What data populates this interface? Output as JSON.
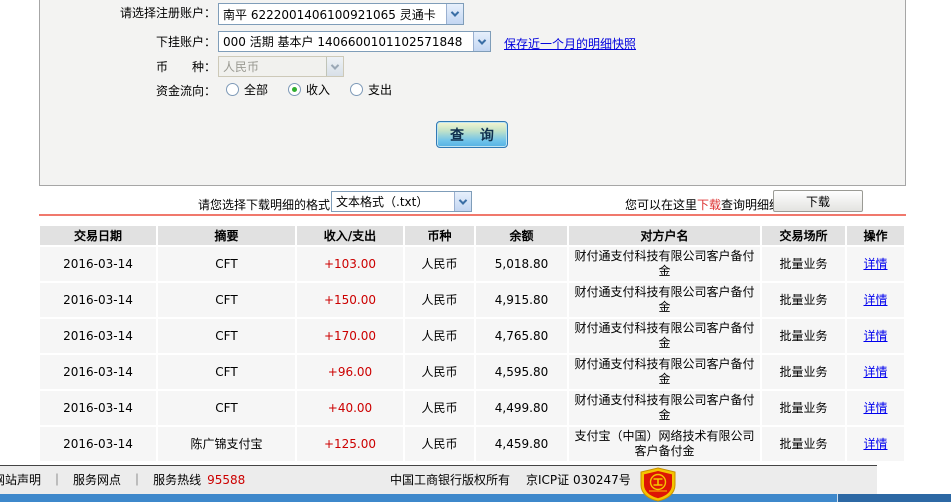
{
  "form": {
    "register_account_label": "请选择注册账户：",
    "register_account_value": "南平  6222001406100921065  灵通卡",
    "sub_account_label": "下挂账户：",
    "sub_account_value": "000  活期  基本户  1406600101102571848",
    "snapshot_link": "保存近一个月的明细快照",
    "currency_label": "币　　种：",
    "currency_value": "人民币",
    "flow_label": "资金流向：",
    "flow_options": [
      {
        "label": "全部",
        "selected": false
      },
      {
        "label": "收入",
        "selected": true
      },
      {
        "label": "支出",
        "selected": false
      }
    ],
    "query_button": "查 询"
  },
  "download": {
    "format_label": "请您选择下载明细的格式",
    "format_value": "文本格式（.txt）",
    "hint_prefix": "您可以在这里",
    "hint_link": "下载",
    "hint_suffix": "查询明细结果",
    "download_button": "下载"
  },
  "table": {
    "headers": [
      "交易日期",
      "摘要",
      "收入/支出",
      "币种",
      "余额",
      "对方户名",
      "交易场所",
      "操作"
    ],
    "rows": [
      {
        "date": "2016-03-14",
        "summary": "CFT",
        "amount": "+103.00",
        "currency": "人民币",
        "balance": "5,018.80",
        "counterparty": "财付通支付科技有限公司客户备付金",
        "venue": "批量业务",
        "action": "详情"
      },
      {
        "date": "2016-03-14",
        "summary": "CFT",
        "amount": "+150.00",
        "currency": "人民币",
        "balance": "4,915.80",
        "counterparty": "财付通支付科技有限公司客户备付金",
        "venue": "批量业务",
        "action": "详情"
      },
      {
        "date": "2016-03-14",
        "summary": "CFT",
        "amount": "+170.00",
        "currency": "人民币",
        "balance": "4,765.80",
        "counterparty": "财付通支付科技有限公司客户备付金",
        "venue": "批量业务",
        "action": "详情"
      },
      {
        "date": "2016-03-14",
        "summary": "CFT",
        "amount": "+96.00",
        "currency": "人民币",
        "balance": "4,595.80",
        "counterparty": "财付通支付科技有限公司客户备付金",
        "venue": "批量业务",
        "action": "详情"
      },
      {
        "date": "2016-03-14",
        "summary": "CFT",
        "amount": "+40.00",
        "currency": "人民币",
        "balance": "4,499.80",
        "counterparty": "财付通支付科技有限公司客户备付金",
        "venue": "批量业务",
        "action": "详情"
      },
      {
        "date": "2016-03-14",
        "summary": "陈广锦支付宝",
        "amount": "+125.00",
        "currency": "人民币",
        "balance": "4,459.80",
        "counterparty": "支付宝（中国）网络技术有限公司客户备付金",
        "venue": "批量业务",
        "action": "详情"
      }
    ]
  },
  "footer": {
    "link_site_statement": "网站声明",
    "link_service_outlets": "服务网点",
    "hotline_label": "服务热线",
    "hotline_number": "95588",
    "copyright": "中国工商银行版权所有",
    "icp": "京ICP证 030247号",
    "badge_icon": "security-badge"
  },
  "colors": {
    "red_line": "#f0786c",
    "amount_red": "#cc0000",
    "link_blue": "#0000dd",
    "footer_bar_blue": "#3e88cb",
    "panel_bg": "#f3f3f2"
  }
}
